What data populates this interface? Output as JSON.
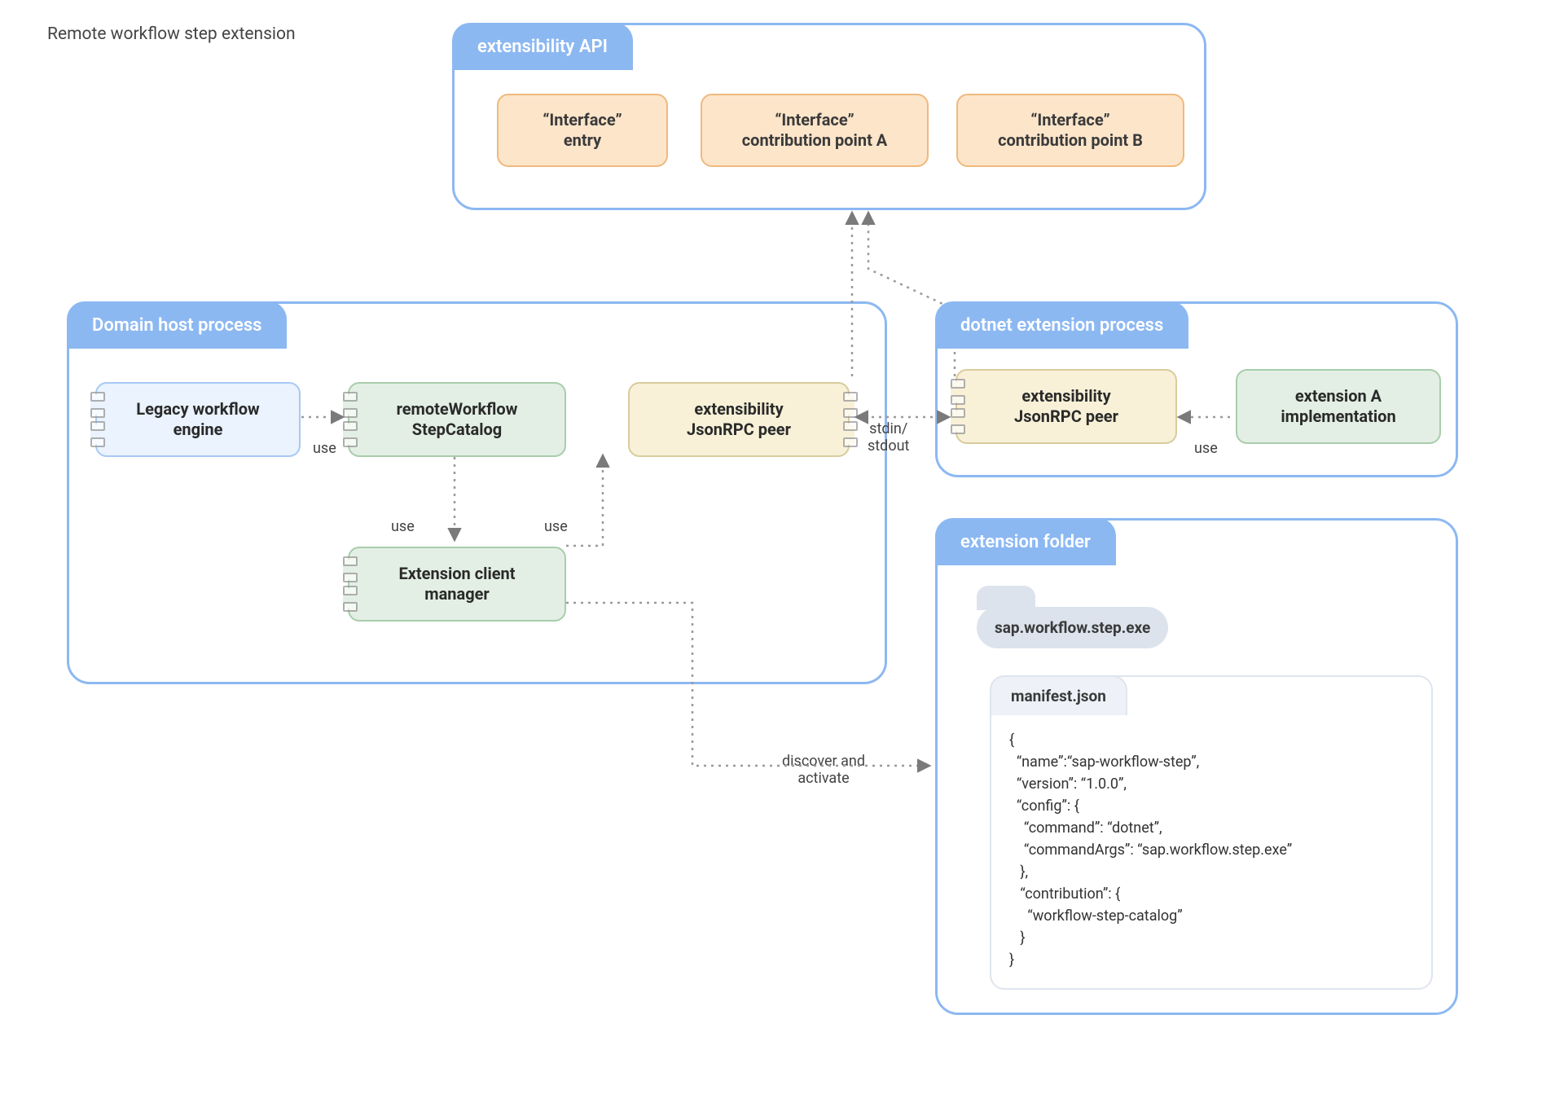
{
  "title": "Remote workflow step extension",
  "containers": {
    "api": {
      "title": "extensibility API"
    },
    "host": {
      "title": "Domain host process"
    },
    "dotnet": {
      "title": "dotnet extension process"
    },
    "folder": {
      "title": "extension folder"
    }
  },
  "api_boxes": {
    "entry": {
      "line1": "“Interface”",
      "line2": "entry"
    },
    "cpa": {
      "line1": "“Interface”",
      "line2": "contribution point A"
    },
    "cpb": {
      "line1": "“Interface”",
      "line2": "contribution point B"
    }
  },
  "host_boxes": {
    "legacy": {
      "line1": "Legacy workflow",
      "line2": "engine"
    },
    "catalog": {
      "line1": "remoteWorkflow",
      "line2": "StepCatalog"
    },
    "peer": {
      "line1": "extensibility",
      "line2": "JsonRPC peer"
    },
    "mgr": {
      "line1": "Extension client",
      "line2": "manager"
    }
  },
  "dotnet_boxes": {
    "peer": {
      "line1": "extensibility",
      "line2": "JsonRPC peer"
    },
    "impl": {
      "line1": "extension A",
      "line2": "implementation"
    }
  },
  "labels": {
    "use1": "use",
    "use2": "use",
    "use3": "use",
    "use4": "use",
    "stdio": "stdin/\nstdout",
    "discover": "discover and\nactivate"
  },
  "folder": {
    "exe": "sap.workflow.step.exe",
    "manifest_title": "manifest.json",
    "manifest_body": "{\n  “name”:“sap-workflow-step”,\n  “version”: “1.0.0”,\n  “config”: {\n    “command”: “dotnet”,\n    “commandArgs”: “sap.workflow.step.exe”\n   },\n   “contribution”: {\n     “workflow-step-catalog”\n   }\n}"
  }
}
